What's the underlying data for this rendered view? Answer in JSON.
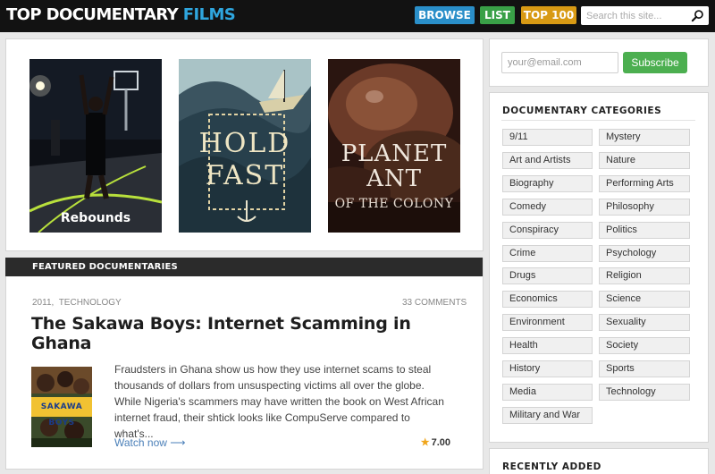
{
  "header": {
    "logo": {
      "part1": "TOP",
      "part2": "DOCUMENTARY",
      "part3": "FILMS"
    },
    "nav": [
      {
        "label": "BROWSE",
        "color": "#2a8fc9"
      },
      {
        "label": "LIST",
        "color": "#39a047"
      },
      {
        "label": "TOP 100",
        "color": "#d89a14"
      }
    ],
    "search": {
      "placeholder": "Search this site...",
      "icon": "search-icon"
    }
  },
  "posters": [
    {
      "title": "Rebounds"
    },
    {
      "title": "Hold Fast",
      "line1": "HOLD",
      "line2": "FAST"
    },
    {
      "title": "Planet Ant",
      "line1": "PLANET",
      "line2": "ANT",
      "line3": "OF THE COLONY"
    }
  ],
  "featured": {
    "section_title": "FEATURED DOCUMENTARIES",
    "year": "2011",
    "separator": ",",
    "category": "TECHNOLOGY",
    "comments": "33 COMMENTS",
    "title": "The Sakawa Boys: Internet Scamming in Ghana",
    "thumb_text": "SAKAWA BOYS",
    "description": "Fraudsters in Ghana show us how they use internet scams to steal thousands of dollars from unsuspecting victims all over the globe. While Nigeria's scammers may have written the book on West African internet fraud, their shtick looks like CompuServe compared to what's...",
    "watch_label": "Watch now ⟶",
    "rating": "7.00",
    "rating_icon": "star-icon"
  },
  "newsletter": {
    "placeholder": "your@email.com",
    "button": "Subscribe",
    "button_color": "#4caf50"
  },
  "categories": {
    "title": "DOCUMENTARY CATEGORIES",
    "left": [
      "9/11",
      "Art and Artists",
      "Biography",
      "Comedy",
      "Conspiracy",
      "Crime",
      "Drugs",
      "Economics",
      "Environment",
      "Health",
      "History",
      "Media",
      "Military and War"
    ],
    "right": [
      "Mystery",
      "Nature",
      "Performing Arts",
      "Philosophy",
      "Politics",
      "Psychology",
      "Religion",
      "Science",
      "Sexuality",
      "Society",
      "Sports",
      "Technology"
    ]
  },
  "recent": {
    "title": "RECENTLY ADDED"
  }
}
